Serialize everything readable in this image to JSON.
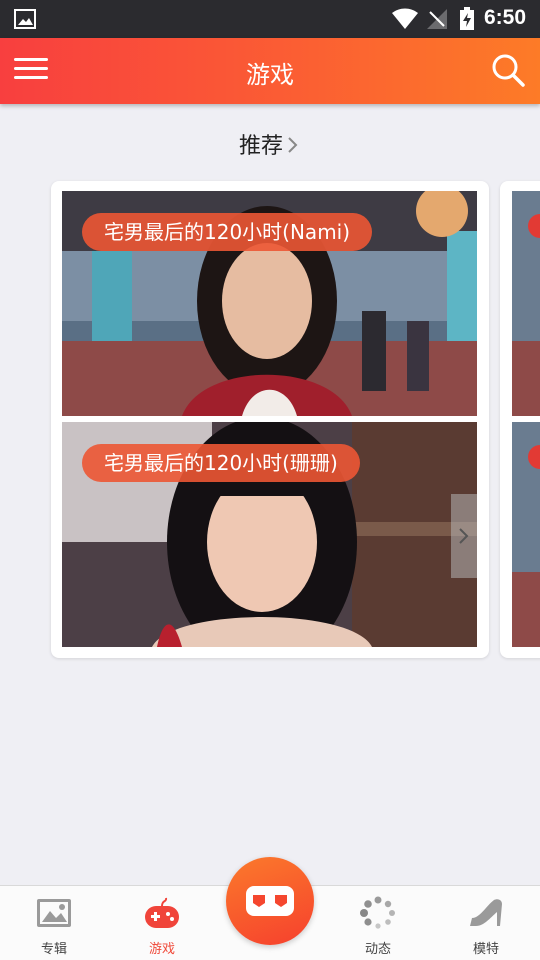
{
  "status_bar": {
    "time": "6:50",
    "icons": [
      "image-notification-icon",
      "wifi-icon",
      "no-sim-icon",
      "battery-charging-icon"
    ]
  },
  "header": {
    "title": "游戏",
    "menu_icon": "hamburger-menu-icon",
    "search_icon": "search-icon"
  },
  "section": {
    "title": "推荐"
  },
  "cards": [
    {
      "items": [
        {
          "title": "宅男最后的120小时(Nami)"
        },
        {
          "title": "宅男最后的120小时(珊珊)"
        }
      ]
    }
  ],
  "bottom_nav": {
    "tabs": [
      {
        "label": "专辑",
        "icon": "picture-icon"
      },
      {
        "label": "游戏",
        "icon": "gamepad-icon",
        "active": true
      },
      {
        "label": "动态",
        "icon": "loading-dots-icon"
      },
      {
        "label": "模特",
        "icon": "high-heel-icon"
      }
    ],
    "center_icon": "vr-headset-icon"
  },
  "colors": {
    "accent": "#f6472f",
    "header_gradient_start": "#f83f3f",
    "header_gradient_end": "#fd7b27",
    "pill": "#ec5634"
  }
}
